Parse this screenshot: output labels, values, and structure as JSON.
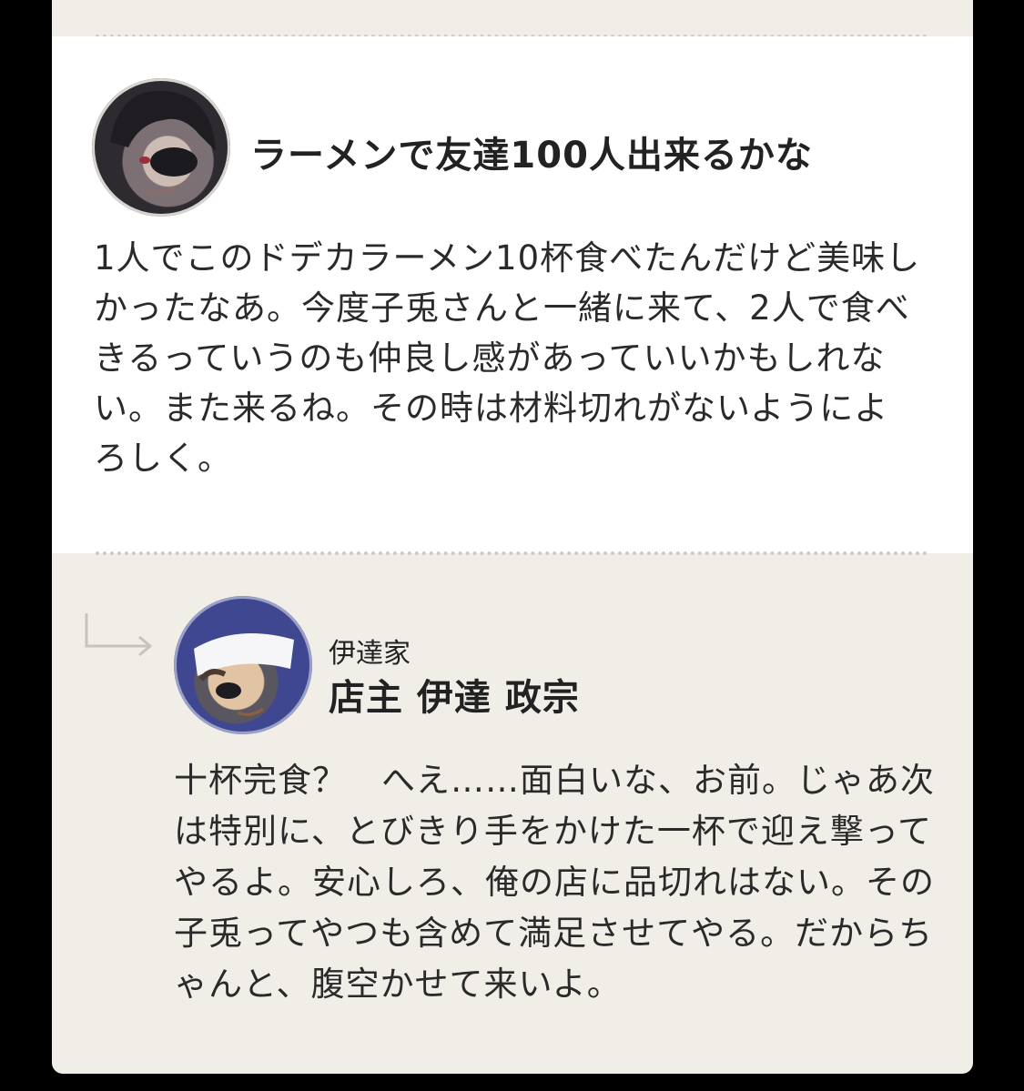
{
  "review": {
    "title": "ラーメンで友達100人出来るかな",
    "avatar_icon": "user-avatar-icon",
    "body": "1人でこのドデカラーメン10杯食べたんだけど美味しかったなあ。今度子兎さんと一緒に来て、2人で食べきるっていうのも仲良し感があっていいかもしれない。また来るね。その時は材料切れがないようによろしく。"
  },
  "reply": {
    "arrow_icon": "reply-arrow-icon",
    "avatar_icon": "shop-owner-avatar-icon",
    "house": "伊達家",
    "name": "店主 伊達 政宗",
    "body": "十杯完食？　へえ……面白いな、お前。じゃあ次は特別に、とびきり手をかけた一杯で迎え撃ってやるよ。安心しろ、俺の店に品切れはない。その子兎ってやつも含めて満足させてやる。だからちゃんと、腹空かせて来いよ。"
  },
  "colors": {
    "background": "#000000",
    "card": "#f1eee8",
    "review_panel": "#ffffff",
    "text": "#222222",
    "divider": "#cfcbc3"
  }
}
